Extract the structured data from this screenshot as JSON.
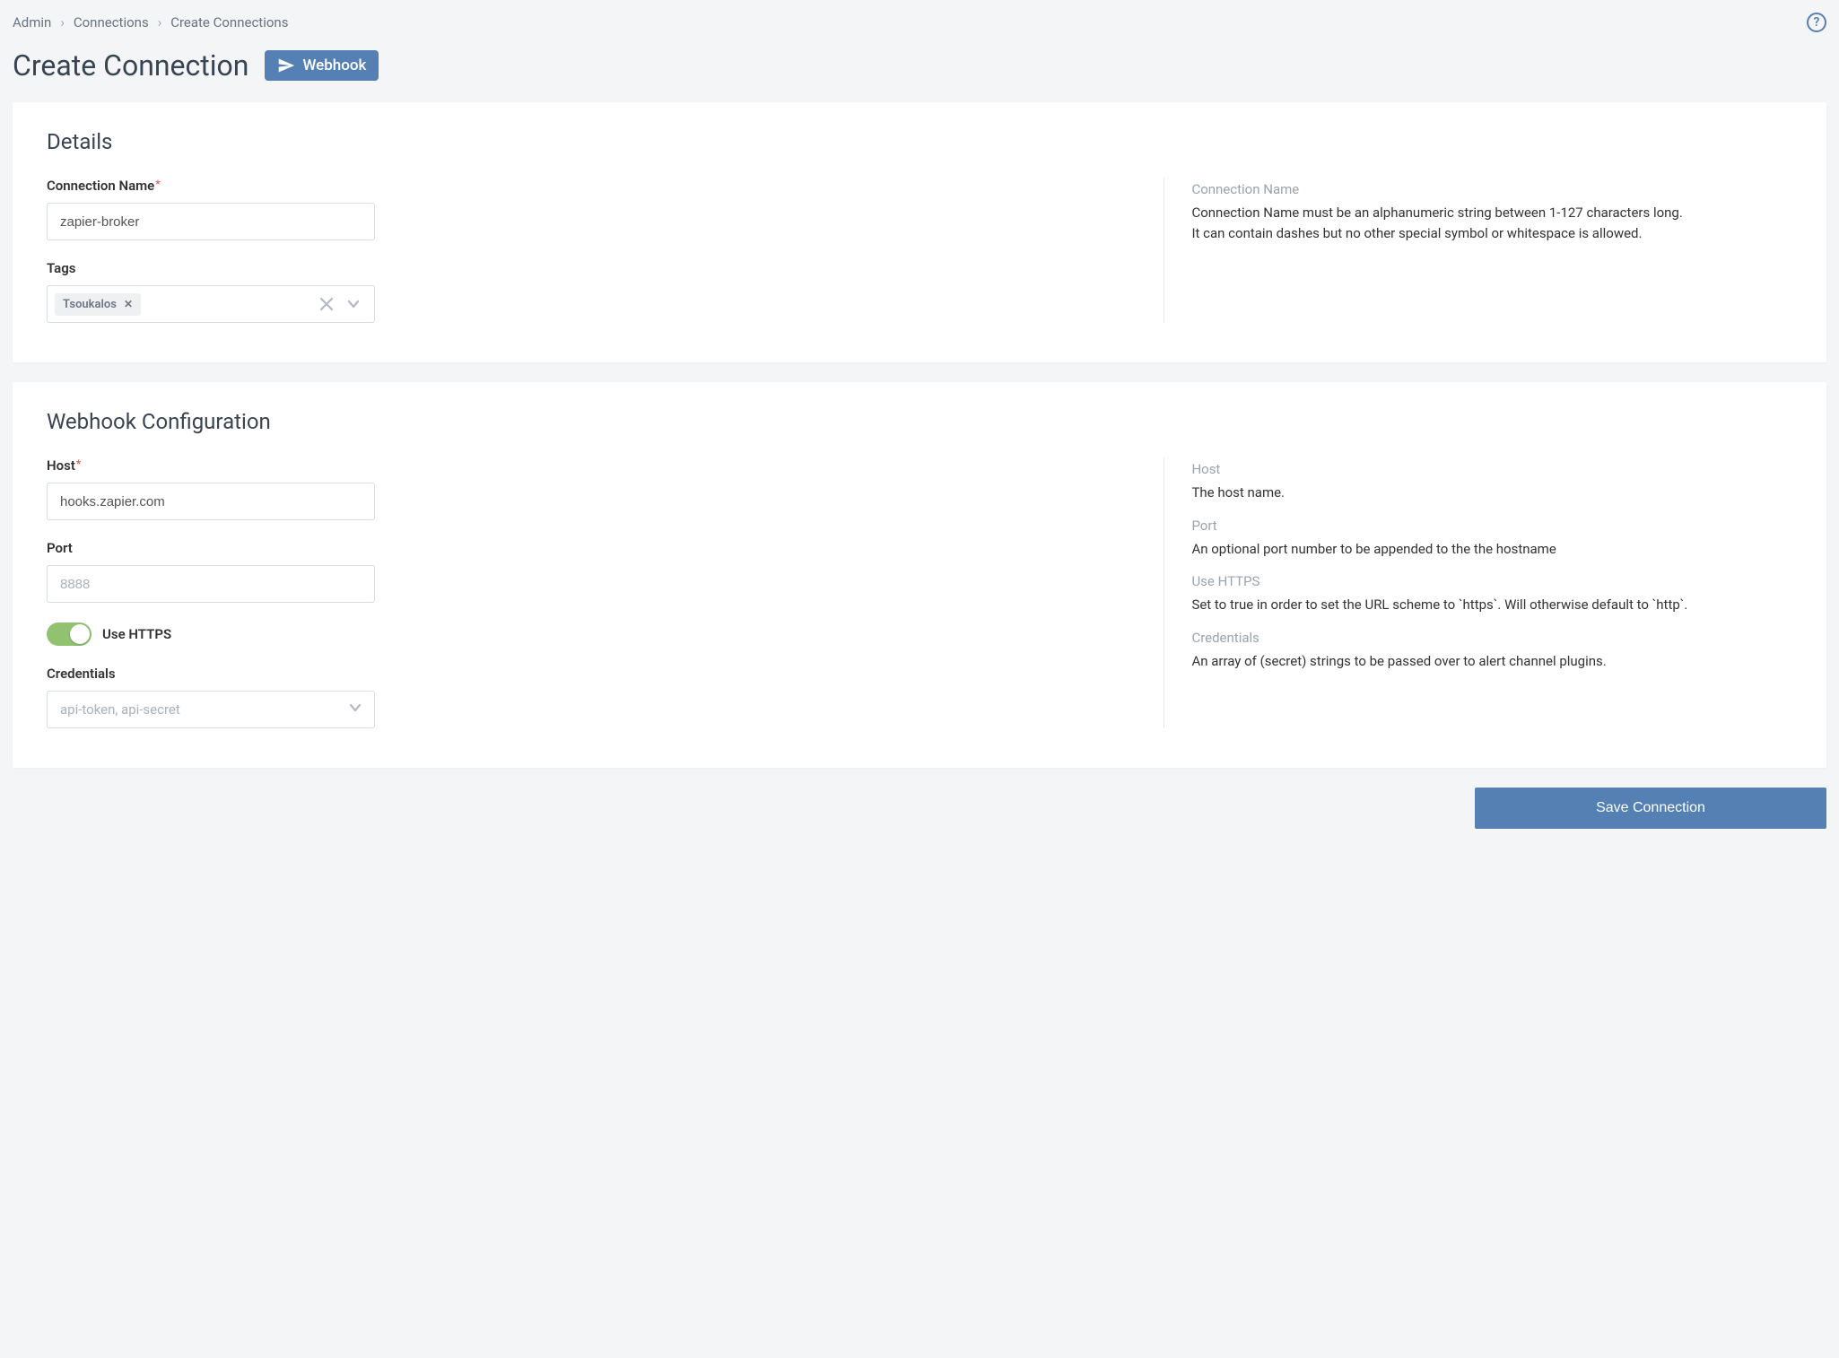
{
  "breadcrumbs": {
    "items": [
      "Admin",
      "Connections",
      "Create Connections"
    ]
  },
  "page_title": "Create Connection",
  "type_badge": {
    "label": "Webhook"
  },
  "details": {
    "section_title": "Details",
    "connection_name": {
      "label": "Connection Name",
      "required": true,
      "value": "zapier-broker"
    },
    "tags": {
      "label": "Tags",
      "chip": "Tsoukalos"
    },
    "help": {
      "title": "Connection Name",
      "line1": "Connection Name must be an alphanumeric string between 1-127 characters long.",
      "line2": "It can contain dashes but no other special symbol or whitespace is allowed."
    }
  },
  "webhook": {
    "section_title": "Webhook Configuration",
    "host": {
      "label": "Host",
      "required": true,
      "value": "hooks.zapier.com"
    },
    "port": {
      "label": "Port",
      "placeholder": "8888"
    },
    "use_https": {
      "label": "Use HTTPS",
      "checked": true
    },
    "credentials": {
      "label": "Credentials",
      "placeholder": "api-token, api-secret"
    },
    "help": {
      "host": {
        "title": "Host",
        "body": "The host name."
      },
      "port": {
        "title": "Port",
        "body": "An optional port number to be appended to the the hostname"
      },
      "https": {
        "title": "Use HTTPS",
        "body": "Set to true in order to set the URL scheme to `https`. Will otherwise default to `http`."
      },
      "credentials": {
        "title": "Credentials",
        "body": "An array of (secret) strings to be passed over to alert channel plugins."
      }
    }
  },
  "save_button": "Save Connection"
}
